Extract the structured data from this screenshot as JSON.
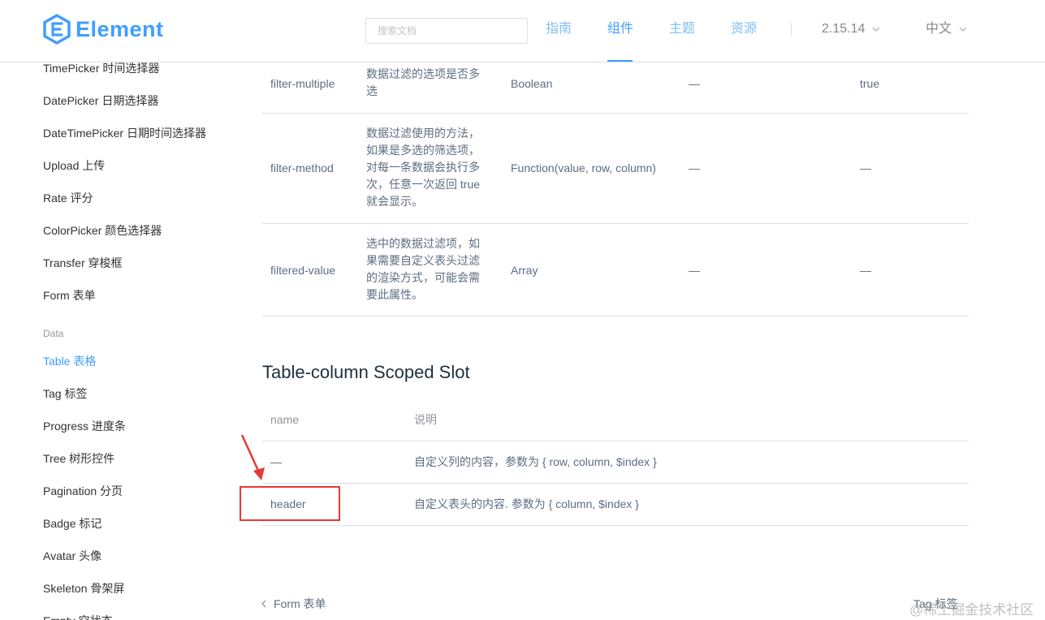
{
  "header": {
    "logo_text": "Element",
    "search_placeholder": "搜索文档",
    "nav": {
      "guide": "指南",
      "component": "组件",
      "theme": "主题",
      "resource": "资源"
    },
    "version": "2.15.14",
    "language": "中文"
  },
  "sidebar": {
    "items_form": [
      "TimePicker 时间选择器",
      "DatePicker 日期选择器",
      "DateTimePicker 日期时间选择器",
      "Upload 上传",
      "Rate 评分",
      "ColorPicker 颜色选择器",
      "Transfer 穿梭框",
      "Form 表单"
    ],
    "group_data": "Data",
    "items_data": [
      "Table 表格",
      "Tag 标签",
      "Progress 进度条",
      "Tree 树形控件",
      "Pagination 分页",
      "Badge 标记",
      "Avatar 头像",
      "Skeleton 骨架屏",
      "Empty 空状态"
    ]
  },
  "attributes_table": {
    "rows": [
      {
        "param": "filter-multiple",
        "desc_lines": [
          "数据过滤的选项是否多",
          "选"
        ],
        "type": "Boolean",
        "options": "—",
        "default": "true"
      },
      {
        "param": "filter-method",
        "desc_lines": [
          "数据过滤使用的方法，",
          "如果是多选的筛选项，",
          "对每一条数据会执行多",
          "次，任意一次返回 true",
          "就会显示。"
        ],
        "type": "Function(value, row, column)",
        "options": "—",
        "default": "—"
      },
      {
        "param": "filtered-value",
        "desc_lines": [
          "选中的数据过滤项，如",
          "果需要自定义表头过滤",
          "的渲染方式，可能会需",
          "要此属性。"
        ],
        "type": "Array",
        "options": "—",
        "default": "—"
      }
    ]
  },
  "scoped_slot": {
    "title": "Table-column Scoped Slot",
    "headers": {
      "name": "name",
      "desc": "说明"
    },
    "rows": [
      {
        "name": "—",
        "desc": "自定义列的内容，参数为 { row, column, $index }"
      },
      {
        "name": "header",
        "desc": "自定义表头的内容. 参数为 { column, $index }"
      }
    ]
  },
  "footer": {
    "prev": "Form 表单",
    "next": "Tag 标签"
  },
  "watermark": "@稀土掘金技术社区",
  "colors": {
    "accent": "#409eff",
    "annotation": "#e53935"
  }
}
